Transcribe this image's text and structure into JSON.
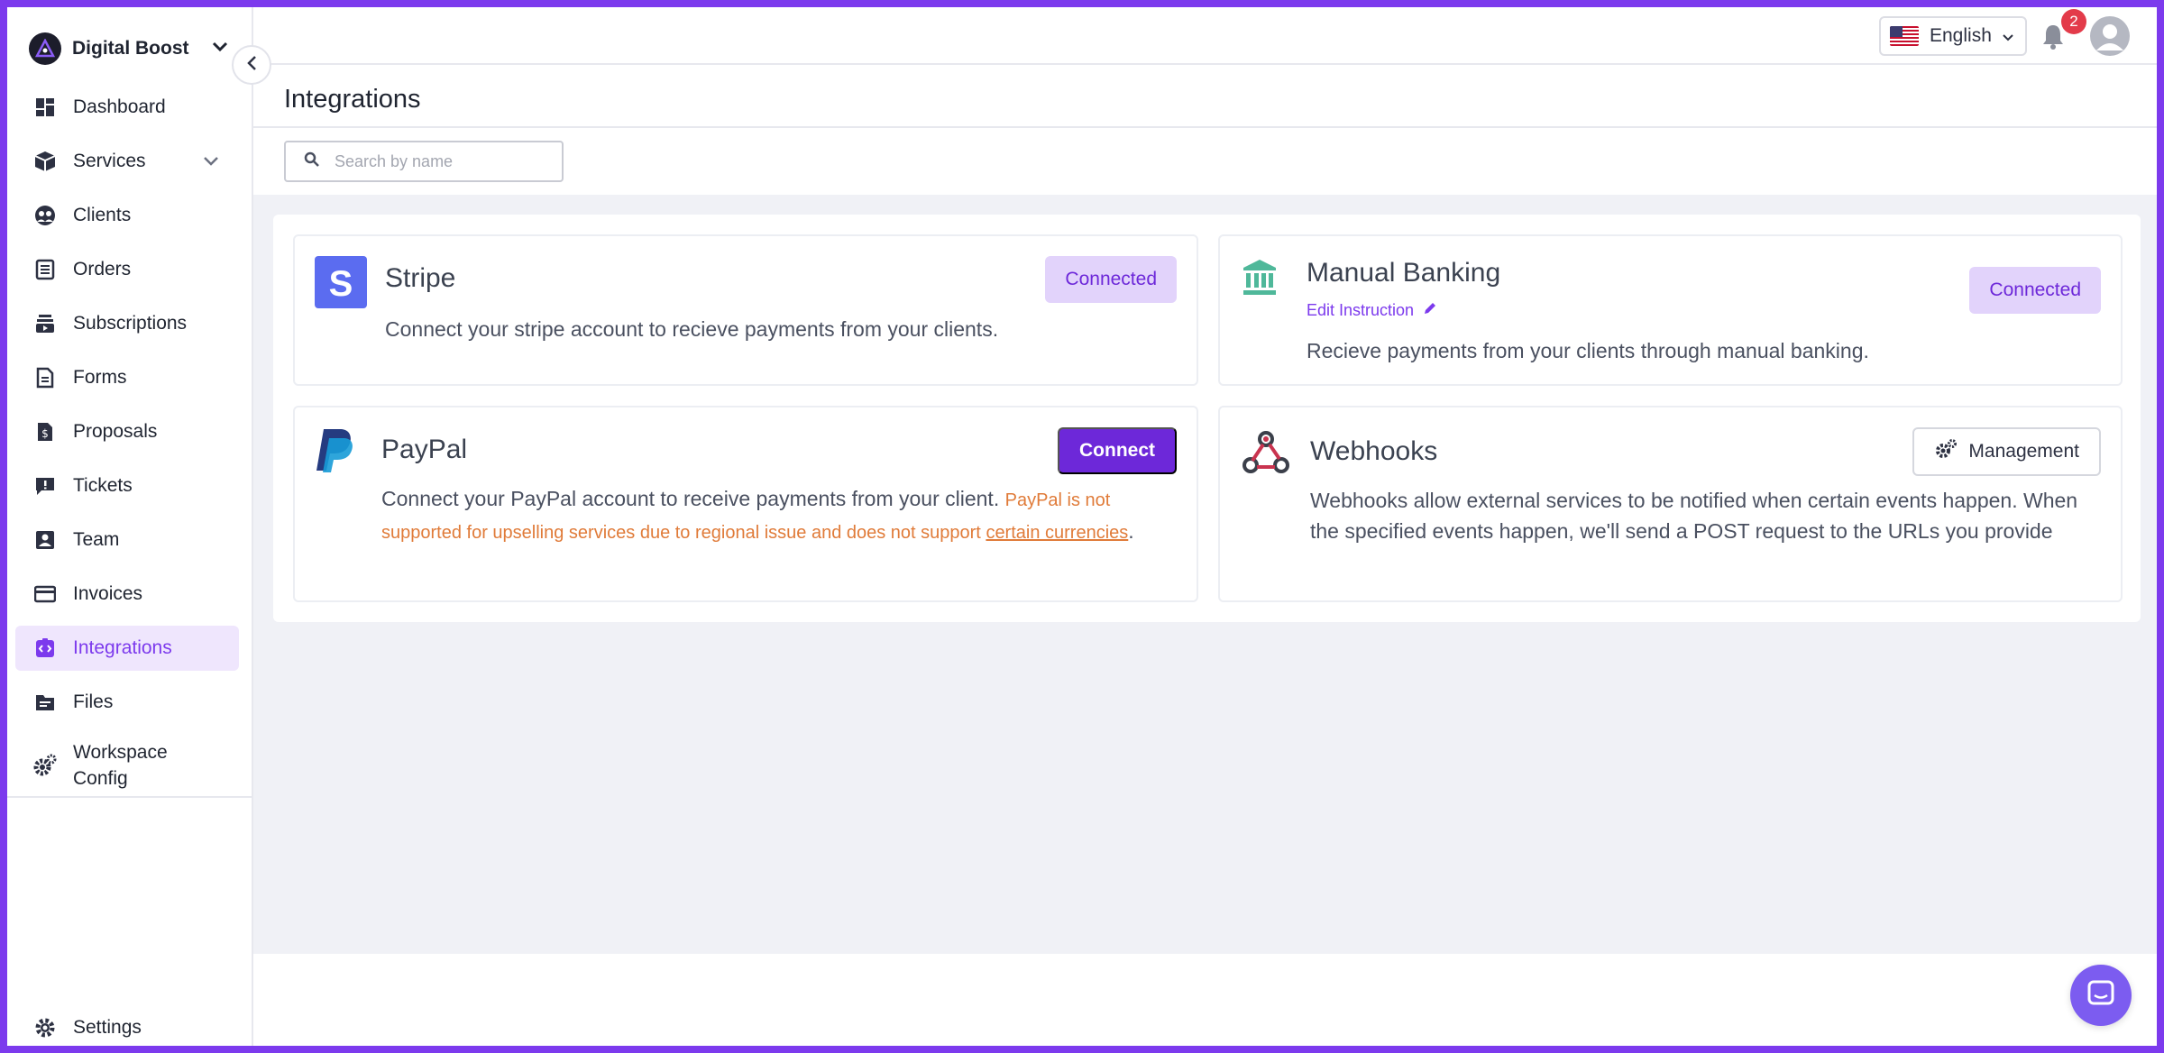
{
  "workspace": {
    "name": "Digital Boost"
  },
  "sidebar": {
    "items": [
      {
        "label": "Dashboard"
      },
      {
        "label": "Services"
      },
      {
        "label": "Clients"
      },
      {
        "label": "Orders"
      },
      {
        "label": "Subscriptions"
      },
      {
        "label": "Forms"
      },
      {
        "label": "Proposals"
      },
      {
        "label": "Tickets"
      },
      {
        "label": "Team"
      },
      {
        "label": "Invoices"
      },
      {
        "label": "Integrations"
      },
      {
        "label": "Files"
      },
      {
        "label": "Workspace Config"
      }
    ],
    "active": "Integrations",
    "settings_label": "Settings"
  },
  "topbar": {
    "language": "English",
    "notification_count": "2"
  },
  "page": {
    "title": "Integrations",
    "search_placeholder": "Search by name"
  },
  "integrations": {
    "stripe": {
      "name": "Stripe",
      "description": "Connect your stripe account to recieve payments from your clients.",
      "status": "Connected"
    },
    "manual_banking": {
      "name": "Manual Banking",
      "edit_label": "Edit Instruction",
      "description": "Recieve payments from your clients through manual banking.",
      "status": "Connected"
    },
    "paypal": {
      "name": "PayPal",
      "description": "Connect your PayPal account to receive payments from your client.",
      "warning": "PayPal is not supported for upselling services due to regional issue and does not support",
      "warning_link": "certain currencies",
      "warning_end": ".",
      "action": "Connect"
    },
    "webhooks": {
      "name": "Webhooks",
      "description": "Webhooks allow external services to be notified when certain events happen. When the specified events happen, we'll send a POST request to the URLs you provide",
      "action": "Management"
    }
  },
  "colors": {
    "accent": "#7c3aed",
    "frame": "#7c3aed",
    "connected_bg": "#e2d3fb",
    "warning": "#e07b39",
    "badge": "#e33b4a"
  }
}
